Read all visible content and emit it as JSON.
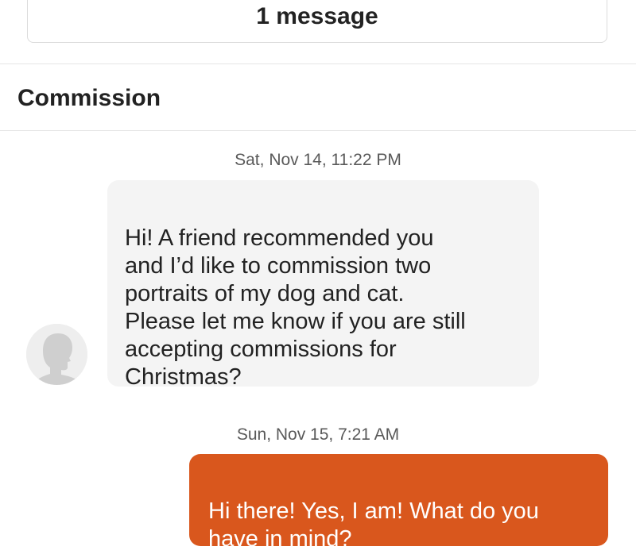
{
  "header": {
    "message_count": "1 message"
  },
  "conversation": {
    "subject": "Commission",
    "messages": [
      {
        "timestamp": "Sat, Nov 14, 11:22 PM",
        "direction": "received",
        "text": "Hi! A friend recommended you\nand I’d like to commission two\nportraits of my dog and cat.\nPlease let me know if you are still\naccepting commissions for\nChristmas?",
        "avatar_icon": "user-silhouette-icon"
      },
      {
        "timestamp": "Sun, Nov 15, 7:21 AM",
        "direction": "sent",
        "text": "Hi there! Yes, I am! What do you\nhave in mind?"
      }
    ]
  },
  "colors": {
    "sent_bubble": "#d9571d",
    "received_bubble": "#f4f4f4",
    "timestamp_text": "#595959"
  }
}
